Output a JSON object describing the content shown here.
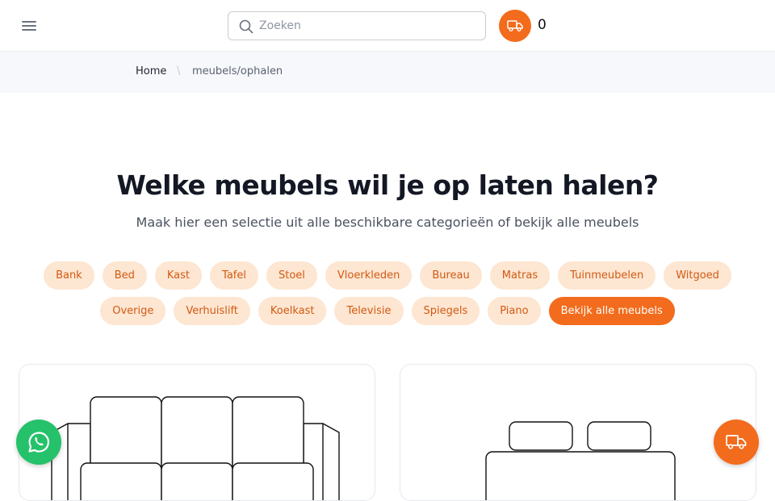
{
  "header": {
    "search_placeholder": "Zoeken",
    "search_value": "",
    "cart_count": "0",
    "icons": {
      "menu": "hamburger-icon",
      "search": "search-icon",
      "cart": "truck-icon"
    }
  },
  "breadcrumb": {
    "home": "Home",
    "separator": "\\",
    "current": "meubels/ophalen"
  },
  "main": {
    "title": "Welke meubels wil je op laten halen?",
    "subtitle": "Maak hier een selectie uit alle beschikbare categorieën of bekijk alle meubels",
    "categories_row1": [
      "Bank",
      "Bed",
      "Kast",
      "Tafel",
      "Stoel",
      "Vloerkleden",
      "Bureau",
      "Matras",
      "Tuinmeubelen",
      "Witgoed"
    ],
    "categories_row2": [
      "Overige",
      "Verhuislift",
      "Koelkast",
      "Televisie",
      "Spiegels",
      "Piano"
    ],
    "view_all_label": "Bekijk alle meubels",
    "cards": [
      {
        "illustration": "sofa-icon"
      },
      {
        "illustration": "bed-icon"
      }
    ]
  },
  "floating": {
    "whatsapp": "whatsapp-icon",
    "truck": "truck-icon"
  },
  "colors": {
    "accent": "#f36b1c",
    "chip_bg": "#fde6d2",
    "chip_text": "#d25a12",
    "whatsapp": "#25c16b",
    "breadcrumb_bg": "#f6f8fb"
  }
}
